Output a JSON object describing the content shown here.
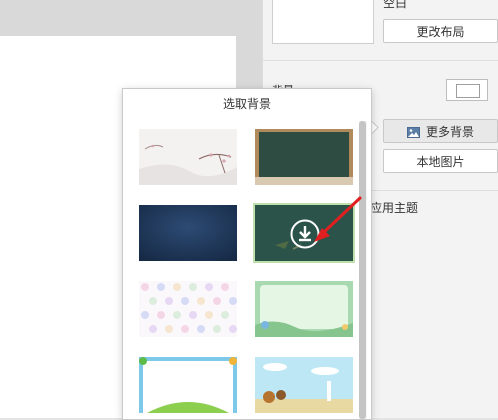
{
  "canvas": {},
  "right_panel": {
    "top_label": "空白",
    "change_layout": "更改布局",
    "background_section_label": "背景",
    "more_backgrounds": "更多背景",
    "local_image": "本地图片",
    "apply_theme": "应用主题"
  },
  "popup": {
    "title": "选取背景",
    "thumbnails": [
      {
        "name": "ink-plum-blossom",
        "colors": [
          "#f1efee",
          "#c9a9a8"
        ]
      },
      {
        "name": "chalkboard-wood-frame",
        "colors": [
          "#2f4c43",
          "#a98656"
        ]
      },
      {
        "name": "navy-gradient",
        "colors": [
          "#1d3556",
          "#2b4a73"
        ]
      },
      {
        "name": "green-chalkboard-selected",
        "colors": [
          "#2c5349",
          "#bfe0ac"
        ]
      },
      {
        "name": "pastel-polka-dots",
        "colors": [
          "#fbf8fb",
          "#cdd3f2"
        ]
      },
      {
        "name": "green-cartoon-frame",
        "colors": [
          "#d9f3db",
          "#9ed2a6"
        ]
      },
      {
        "name": "blue-frame-grass",
        "colors": [
          "#ffffff",
          "#74c8ea"
        ]
      },
      {
        "name": "sky-landscape",
        "colors": [
          "#b9e6f4",
          "#e7d9a7"
        ]
      }
    ],
    "download_icon": "download-icon",
    "annotation": {
      "color": "#e02020"
    }
  }
}
